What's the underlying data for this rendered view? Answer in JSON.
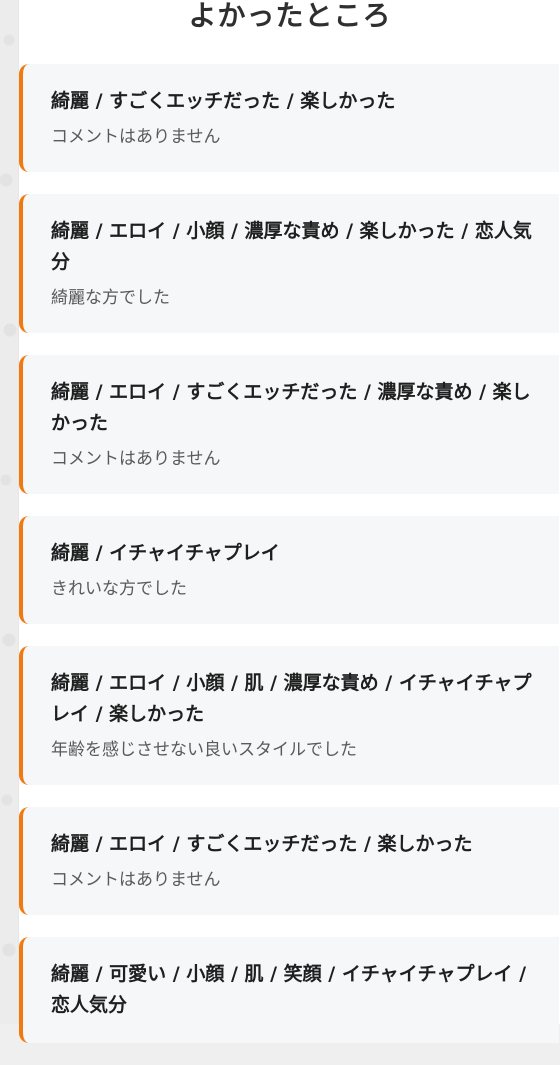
{
  "section": {
    "title": "よかったところ"
  },
  "reviews": [
    {
      "tags": "綺麗 / すごくエッチだった / 楽しかった",
      "comment": "コメントはありません"
    },
    {
      "tags": "綺麗 / エロイ / 小顔 / 濃厚な責め / 楽しかった / 恋人気分",
      "comment": "綺麗な方でした"
    },
    {
      "tags": "綺麗 / エロイ / すごくエッチだった / 濃厚な責め / 楽しかった",
      "comment": "コメントはありません"
    },
    {
      "tags": "綺麗 / イチャイチャプレイ",
      "comment": "きれいな方でした"
    },
    {
      "tags": "綺麗 / エロイ / 小顔 / 肌 / 濃厚な責め / イチャイチャプレイ / 楽しかった",
      "comment": "年齢を感じさせない良いスタイルでした"
    },
    {
      "tags": "綺麗 / エロイ / すごくエッチだった / 楽しかった",
      "comment": "コメントはありません"
    },
    {
      "tags": "綺麗 / 可愛い / 小顔 / 肌 / 笑顔 / イチャイチャプレイ / 恋人気分",
      "comment": ""
    }
  ],
  "colors": {
    "accent": "#f07a12",
    "card_background": "#f5f7f8",
    "title_text": "#2f2f2f",
    "tag_text": "#1f1f1f",
    "comment_text": "#5a5a5a"
  }
}
